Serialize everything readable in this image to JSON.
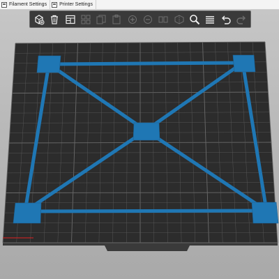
{
  "window": {
    "tabs": [
      {
        "label": "Filament Settings",
        "icon": "filament-settings-icon"
      },
      {
        "label": "Printer Settings",
        "icon": "printer-settings-icon"
      }
    ]
  },
  "toolbar": {
    "buttons": [
      {
        "name": "add-button",
        "icon": "add-cube-icon",
        "enabled": true
      },
      {
        "name": "delete-button",
        "icon": "trash-icon",
        "enabled": true
      },
      {
        "name": "delete-all-button",
        "icon": "delete-all-icon",
        "enabled": true
      },
      {
        "name": "arrange-button",
        "icon": "arrange-icon",
        "enabled": false
      },
      {
        "name": "copy-button",
        "icon": "copy-icon",
        "enabled": false
      },
      {
        "name": "paste-button",
        "icon": "paste-icon",
        "enabled": false
      },
      {
        "name": "add-instance-button",
        "icon": "plus-icon",
        "enabled": false
      },
      {
        "name": "remove-instance-button",
        "icon": "minus-icon",
        "enabled": false
      },
      {
        "name": "split-objects-button",
        "icon": "split-objects-icon",
        "enabled": false
      },
      {
        "name": "split-parts-button",
        "icon": "split-parts-icon",
        "enabled": false
      },
      {
        "name": "search-button",
        "icon": "search-icon",
        "enabled": true
      },
      {
        "name": "layers-button",
        "icon": "layers-icon",
        "enabled": true
      },
      {
        "name": "undo-button",
        "icon": "undo-icon",
        "enabled": true
      },
      {
        "name": "redo-button",
        "icon": "redo-icon",
        "enabled": false
      }
    ]
  },
  "scene": {
    "bed_color": "#2c2c2c",
    "grid_color": "#5a5a5a",
    "model_color": "#1f77b4",
    "model_edge_color": "#1b5f8f",
    "x_axis_color": "#e02020"
  }
}
